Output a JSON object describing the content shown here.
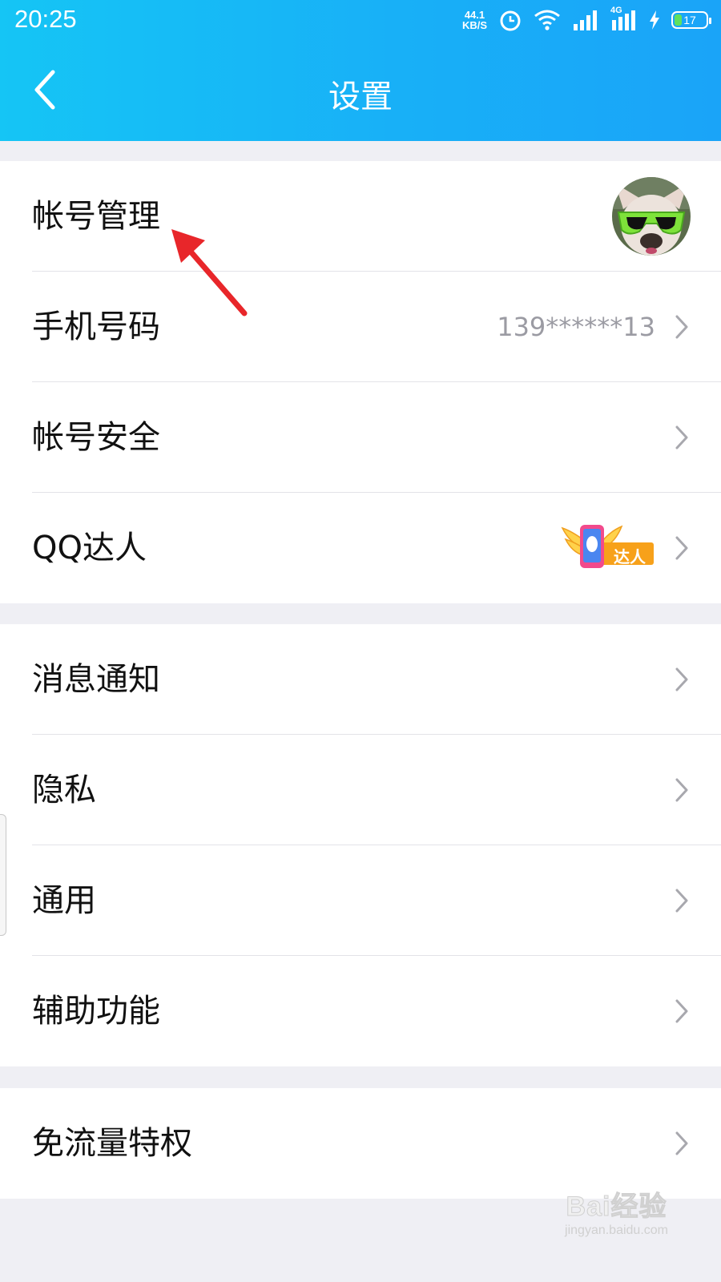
{
  "status_bar": {
    "time": "20:25",
    "net_speed_value": "44.1",
    "net_speed_unit": "KB/S",
    "network_type": "4G",
    "battery_level": "17",
    "icons": [
      "alarm-icon",
      "wifi-icon",
      "signal-icon",
      "signal-4g-icon",
      "charging-icon",
      "battery-icon"
    ]
  },
  "header": {
    "title": "设置",
    "back_icon": "chevron-left-icon",
    "background_colors": [
      "#15c5f5",
      "#1aa4f8"
    ]
  },
  "groups": [
    {
      "items": [
        {
          "label": "帐号管理",
          "trailing": "avatar"
        },
        {
          "label": "手机号码",
          "value": "139******13",
          "trailing": "chevron"
        },
        {
          "label": "帐号安全",
          "trailing": "chevron"
        },
        {
          "label": "QQ达人",
          "badge_text": "达人",
          "trailing": "chevron"
        }
      ]
    },
    {
      "items": [
        {
          "label": "消息通知",
          "trailing": "chevron"
        },
        {
          "label": "隐私",
          "trailing": "chevron"
        },
        {
          "label": "通用",
          "trailing": "chevron"
        },
        {
          "label": "辅助功能",
          "trailing": "chevron"
        }
      ]
    },
    {
      "items": [
        {
          "label": "免流量特权",
          "trailing": "chevron"
        }
      ]
    }
  ],
  "annotation": {
    "icon": "red-arrow-icon",
    "color": "#e8262a"
  },
  "watermark": {
    "main": "Bai经验",
    "sub": "jingyan.baidu.com"
  }
}
